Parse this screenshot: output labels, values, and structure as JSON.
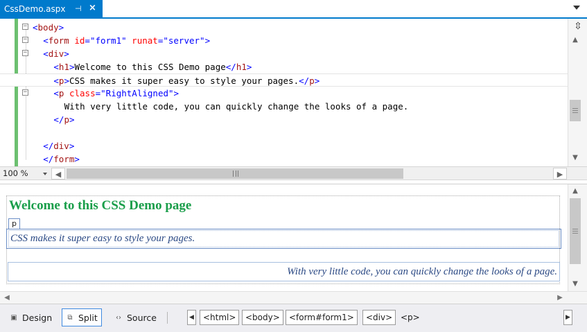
{
  "tab": {
    "title": "CssDemo.aspx",
    "pin": "⊣",
    "close": "×"
  },
  "code_lines": [
    {
      "indent": "",
      "parts": [
        [
          "br",
          "<"
        ],
        [
          "tg",
          "body"
        ],
        [
          "br",
          ">"
        ]
      ],
      "fold": "−"
    },
    {
      "indent": "  ",
      "parts": [
        [
          "br",
          "<"
        ],
        [
          "tg",
          "form"
        ],
        [
          "tx",
          " "
        ],
        [
          "at",
          "id"
        ],
        [
          "br",
          "="
        ],
        [
          "av",
          "\"form1\""
        ],
        [
          "tx",
          " "
        ],
        [
          "at",
          "runat"
        ],
        [
          "br",
          "="
        ],
        [
          "av",
          "\"server\""
        ],
        [
          "br",
          ">"
        ]
      ],
      "fold": "−"
    },
    {
      "indent": "  ",
      "parts": [
        [
          "br",
          "<"
        ],
        [
          "tg",
          "div"
        ],
        [
          "br",
          ">"
        ]
      ],
      "fold": "−"
    },
    {
      "indent": "    ",
      "parts": [
        [
          "br",
          "<"
        ],
        [
          "tg",
          "h1"
        ],
        [
          "br",
          ">"
        ],
        [
          "tx",
          "Welcome to this CSS Demo page"
        ],
        [
          "br",
          "</"
        ],
        [
          "tg",
          "h1"
        ],
        [
          "br",
          ">"
        ]
      ],
      "fold": ""
    },
    {
      "indent": "    ",
      "parts": [
        [
          "br",
          "<"
        ],
        [
          "tg",
          "p"
        ],
        [
          "br",
          ">"
        ],
        [
          "tx",
          "CSS makes it super easy to style your pages."
        ],
        [
          "br",
          "</"
        ],
        [
          "tg",
          "p"
        ],
        [
          "br",
          ">"
        ]
      ],
      "fold": "",
      "current": true
    },
    {
      "indent": "    ",
      "parts": [
        [
          "br",
          "<"
        ],
        [
          "tg",
          "p"
        ],
        [
          "tx",
          " "
        ],
        [
          "at",
          "class"
        ],
        [
          "br",
          "="
        ],
        [
          "av",
          "\"RightAligned\""
        ],
        [
          "br",
          ">"
        ]
      ],
      "fold": "−"
    },
    {
      "indent": "      ",
      "parts": [
        [
          "tx",
          "With very little code, you can quickly change the looks of a page."
        ]
      ],
      "fold": ""
    },
    {
      "indent": "    ",
      "parts": [
        [
          "br",
          "</"
        ],
        [
          "tg",
          "p"
        ],
        [
          "br",
          ">"
        ]
      ],
      "fold": ""
    },
    {
      "indent": "",
      "parts": [],
      "fold": ""
    },
    {
      "indent": "  ",
      "parts": [
        [
          "br",
          "</"
        ],
        [
          "tg",
          "div"
        ],
        [
          "br",
          ">"
        ]
      ],
      "fold": ""
    },
    {
      "indent": "  ",
      "parts": [
        [
          "br",
          "</"
        ],
        [
          "tg",
          "form"
        ],
        [
          "br",
          ">"
        ]
      ],
      "fold": ""
    }
  ],
  "zoom": {
    "level": "100 %"
  },
  "design": {
    "heading": "Welcome to this CSS Demo page",
    "p_tag": "p",
    "paragraph1": "CSS makes it super easy to style your pages.",
    "paragraph2": "With very little code, you can quickly change the looks of a page."
  },
  "views": {
    "design": "Design",
    "split": "Split",
    "source": "Source"
  },
  "breadcrumbs": [
    "<html>",
    "<body>",
    "<form#form1>",
    "<div>",
    "<p>"
  ],
  "icons": {
    "split_window": "split-window-icon",
    "up": "▲",
    "down": "▼",
    "left": "◀",
    "right": "▶"
  },
  "colors": {
    "accent": "#007acc",
    "heading_green": "#1a9e4a",
    "change_bar": "#6cc070"
  }
}
